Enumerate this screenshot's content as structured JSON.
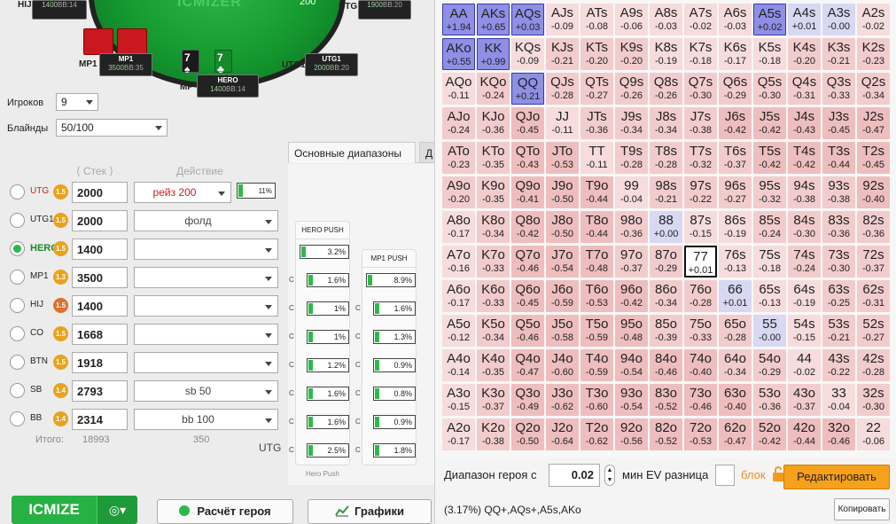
{
  "table": {
    "logo": "ICMIZER",
    "pot": "200",
    "seats": [
      {
        "name": "HIJ",
        "stack": "1400",
        "bb": "BB:14"
      },
      {
        "name": "UTG",
        "stack": "1900",
        "bb": "BB:20"
      },
      {
        "name": "MP1",
        "stack": "3500",
        "bb": "BB:35"
      },
      {
        "name": "HERO",
        "stack": "1400",
        "bb": "BB:14"
      },
      {
        "name": "UTG1",
        "stack": "2000",
        "bb": "BB:20"
      }
    ],
    "labels": {
      "hij": "HIJ",
      "utg": "UTG",
      "mp1": "MP1",
      "mp": "MP",
      "utg1": "UTG1"
    },
    "hero_cards": [
      {
        "rank": "7",
        "suit": "♠"
      },
      {
        "rank": "7",
        "suit": "♣"
      }
    ]
  },
  "settings": {
    "players_label": "Игроков",
    "players_value": "9",
    "blinds_label": "Блайнды",
    "blinds_value": "50/100",
    "stack_header": "Стек",
    "action_header": "Действие"
  },
  "players": [
    {
      "pos": "UTG",
      "coin": "1.5",
      "stack": "2000",
      "action": "рейз 200",
      "pct": "11%"
    },
    {
      "pos": "UTG1",
      "coin": "1.5",
      "stack": "2000",
      "action": "фолд",
      "pct": ""
    },
    {
      "pos": "HERO",
      "coin": "1.5",
      "stack": "1400",
      "action": "",
      "pct": ""
    },
    {
      "pos": "MP1",
      "coin": "1.3",
      "stack": "3500",
      "action": "",
      "pct": ""
    },
    {
      "pos": "HIJ",
      "coin": "1.5",
      "stack": "1400",
      "action": "",
      "pct": ""
    },
    {
      "pos": "CO",
      "coin": "1.5",
      "stack": "1668",
      "action": "",
      "pct": ""
    },
    {
      "pos": "BTN",
      "coin": "1.5",
      "stack": "1918",
      "action": "",
      "pct": ""
    },
    {
      "pos": "SB",
      "coin": "1.4",
      "stack": "2793",
      "action": "sb 50",
      "pct": ""
    },
    {
      "pos": "BB",
      "coin": "1.4",
      "stack": "2314",
      "action": "bb 100",
      "pct": ""
    }
  ],
  "totals": {
    "label": "Итого:",
    "stack": "18993",
    "action": "350",
    "utg": "UTG"
  },
  "tabs": {
    "main": "Основные диапазоны",
    "second": "Д"
  },
  "hero_push": {
    "title": "HERO PUSH",
    "values": [
      "3.2%",
      "1.6%",
      "1%",
      "1%",
      "1.2%",
      "1.6%",
      "1.6%",
      "2.5%"
    ],
    "prefix": "C",
    "footer": "Hero Push"
  },
  "mp1_push": {
    "title": "MP1 PUSH",
    "values": [
      "8.9%",
      "1.6%",
      "1.3%",
      "0.9%",
      "0.8%",
      "0.9%",
      "1.8%"
    ],
    "prefix": "C"
  },
  "buttons": {
    "icmize": "ICMIZE",
    "icmize_drop": "◎▾",
    "calc_hero": "Расчёт героя",
    "charts": "Графики",
    "edit": "Редактировать",
    "copy": "Копировать"
  },
  "range_controls": {
    "hero_range_label": "Диапазон героя с",
    "hero_range_value": "0.02",
    "min_ev_label": "мин EV разница",
    "block_label": "блок",
    "summary": "(3.17%) QQ+,AQs+,A5s,AKo"
  },
  "grid": [
    [
      [
        "AA",
        "+1.94"
      ],
      [
        "AKs",
        "+0.65"
      ],
      [
        "AQs",
        "+0.03"
      ],
      [
        "AJs",
        "-0.09"
      ],
      [
        "ATs",
        "-0.08"
      ],
      [
        "A9s",
        "-0.06"
      ],
      [
        "A8s",
        "-0.03"
      ],
      [
        "A7s",
        "-0.02"
      ],
      [
        "A6s",
        "-0.03"
      ],
      [
        "A5s",
        "+0.02"
      ],
      [
        "A4s",
        "+0.01"
      ],
      [
        "A3s",
        "-0.00"
      ],
      [
        "A2s",
        "-0.02"
      ]
    ],
    [
      [
        "AKo",
        "+0.55"
      ],
      [
        "KK",
        "+0.99"
      ],
      [
        "KQs",
        "-0.09"
      ],
      [
        "KJs",
        "-0.21"
      ],
      [
        "KTs",
        "-0.20"
      ],
      [
        "K9s",
        "-0.20"
      ],
      [
        "K8s",
        "-0.19"
      ],
      [
        "K7s",
        "-0.18"
      ],
      [
        "K6s",
        "-0.17"
      ],
      [
        "K5s",
        "-0.18"
      ],
      [
        "K4s",
        "-0.20"
      ],
      [
        "K3s",
        "-0.21"
      ],
      [
        "K2s",
        "-0.23"
      ]
    ],
    [
      [
        "AQo",
        "-0.11"
      ],
      [
        "KQo",
        "-0.24"
      ],
      [
        "QQ",
        "+0.21"
      ],
      [
        "QJs",
        "-0.28"
      ],
      [
        "QTs",
        "-0.27"
      ],
      [
        "Q9s",
        "-0.26"
      ],
      [
        "Q8s",
        "-0.26"
      ],
      [
        "Q7s",
        "-0.30"
      ],
      [
        "Q6s",
        "-0.29"
      ],
      [
        "Q5s",
        "-0.30"
      ],
      [
        "Q4s",
        "-0.31"
      ],
      [
        "Q3s",
        "-0.33"
      ],
      [
        "Q2s",
        "-0.34"
      ]
    ],
    [
      [
        "AJo",
        "-0.24"
      ],
      [
        "KJo",
        "-0.36"
      ],
      [
        "QJo",
        "-0.45"
      ],
      [
        "JJ",
        "-0.11"
      ],
      [
        "JTs",
        "-0.36"
      ],
      [
        "J9s",
        "-0.34"
      ],
      [
        "J8s",
        "-0.34"
      ],
      [
        "J7s",
        "-0.38"
      ],
      [
        "J6s",
        "-0.42"
      ],
      [
        "J5s",
        "-0.42"
      ],
      [
        "J4s",
        "-0.43"
      ],
      [
        "J3s",
        "-0.45"
      ],
      [
        "J2s",
        "-0.47"
      ]
    ],
    [
      [
        "ATo",
        "-0.23"
      ],
      [
        "KTo",
        "-0.35"
      ],
      [
        "QTo",
        "-0.43"
      ],
      [
        "JTo",
        "-0.53"
      ],
      [
        "TT",
        "-0.11"
      ],
      [
        "T9s",
        "-0.28"
      ],
      [
        "T8s",
        "-0.28"
      ],
      [
        "T7s",
        "-0.32"
      ],
      [
        "T6s",
        "-0.37"
      ],
      [
        "T5s",
        "-0.42"
      ],
      [
        "T4s",
        "-0.42"
      ],
      [
        "T3s",
        "-0.44"
      ],
      [
        "T2s",
        "-0.45"
      ]
    ],
    [
      [
        "A9o",
        "-0.20"
      ],
      [
        "K9o",
        "-0.35"
      ],
      [
        "Q9o",
        "-0.41"
      ],
      [
        "J9o",
        "-0.50"
      ],
      [
        "T9o",
        "-0.44"
      ],
      [
        "99",
        "-0.04"
      ],
      [
        "98s",
        "-0.21"
      ],
      [
        "97s",
        "-0.22"
      ],
      [
        "96s",
        "-0.27"
      ],
      [
        "95s",
        "-0.32"
      ],
      [
        "94s",
        "-0.38"
      ],
      [
        "93s",
        "-0.38"
      ],
      [
        "92s",
        "-0.40"
      ]
    ],
    [
      [
        "A8o",
        "-0.17"
      ],
      [
        "K8o",
        "-0.34"
      ],
      [
        "Q8o",
        "-0.42"
      ],
      [
        "J8o",
        "-0.50"
      ],
      [
        "T8o",
        "-0.44"
      ],
      [
        "98o",
        "-0.36"
      ],
      [
        "88",
        "+0.00"
      ],
      [
        "87s",
        "-0.15"
      ],
      [
        "86s",
        "-0.19"
      ],
      [
        "85s",
        "-0.24"
      ],
      [
        "84s",
        "-0.30"
      ],
      [
        "83s",
        "-0.36"
      ],
      [
        "82s",
        "-0.36"
      ]
    ],
    [
      [
        "A7o",
        "-0.16"
      ],
      [
        "K7o",
        "-0.33"
      ],
      [
        "Q7o",
        "-0.46"
      ],
      [
        "J7o",
        "-0.54"
      ],
      [
        "T7o",
        "-0.48"
      ],
      [
        "97o",
        "-0.37"
      ],
      [
        "87o",
        "-0.29"
      ],
      [
        "77",
        "+0.01"
      ],
      [
        "76s",
        "-0.13"
      ],
      [
        "75s",
        "-0.18"
      ],
      [
        "74s",
        "-0.24"
      ],
      [
        "73s",
        "-0.30"
      ],
      [
        "72s",
        "-0.37"
      ]
    ],
    [
      [
        "A6o",
        "-0.17"
      ],
      [
        "K6o",
        "-0.33"
      ],
      [
        "Q6o",
        "-0.45"
      ],
      [
        "J6o",
        "-0.59"
      ],
      [
        "T6o",
        "-0.53"
      ],
      [
        "96o",
        "-0.42"
      ],
      [
        "86o",
        "-0.34"
      ],
      [
        "76o",
        "-0.28"
      ],
      [
        "66",
        "+0.01"
      ],
      [
        "65s",
        "-0.13"
      ],
      [
        "64s",
        "-0.19"
      ],
      [
        "63s",
        "-0.25"
      ],
      [
        "62s",
        "-0.31"
      ]
    ],
    [
      [
        "A5o",
        "-0.12"
      ],
      [
        "K5o",
        "-0.34"
      ],
      [
        "Q5o",
        "-0.46"
      ],
      [
        "J5o",
        "-0.58"
      ],
      [
        "T5o",
        "-0.59"
      ],
      [
        "95o",
        "-0.48"
      ],
      [
        "85o",
        "-0.39"
      ],
      [
        "75o",
        "-0.33"
      ],
      [
        "65o",
        "-0.28"
      ],
      [
        "55",
        "-0.00"
      ],
      [
        "54s",
        "-0.15"
      ],
      [
        "53s",
        "-0.21"
      ],
      [
        "52s",
        "-0.27"
      ]
    ],
    [
      [
        "A4o",
        "-0.14"
      ],
      [
        "K4o",
        "-0.35"
      ],
      [
        "Q4o",
        "-0.47"
      ],
      [
        "J4o",
        "-0.60"
      ],
      [
        "T4o",
        "-0.59"
      ],
      [
        "94o",
        "-0.54"
      ],
      [
        "84o",
        "-0.46"
      ],
      [
        "74o",
        "-0.40"
      ],
      [
        "64o",
        "-0.34"
      ],
      [
        "54o",
        "-0.29"
      ],
      [
        "44",
        "-0.02"
      ],
      [
        "43s",
        "-0.22"
      ],
      [
        "42s",
        "-0.28"
      ]
    ],
    [
      [
        "A3o",
        "-0.15"
      ],
      [
        "K3o",
        "-0.37"
      ],
      [
        "Q3o",
        "-0.49"
      ],
      [
        "J3o",
        "-0.62"
      ],
      [
        "T3o",
        "-0.60"
      ],
      [
        "93o",
        "-0.54"
      ],
      [
        "83o",
        "-0.52"
      ],
      [
        "73o",
        "-0.46"
      ],
      [
        "63o",
        "-0.40"
      ],
      [
        "53o",
        "-0.36"
      ],
      [
        "43o",
        "-0.37"
      ],
      [
        "33",
        "-0.04"
      ],
      [
        "32s",
        "-0.30"
      ]
    ],
    [
      [
        "A2o",
        "-0.17"
      ],
      [
        "K2o",
        "-0.38"
      ],
      [
        "Q2o",
        "-0.50"
      ],
      [
        "J2o",
        "-0.64"
      ],
      [
        "T2o",
        "-0.62"
      ],
      [
        "92o",
        "-0.56"
      ],
      [
        "82o",
        "-0.52"
      ],
      [
        "72o",
        "-0.53"
      ],
      [
        "62o",
        "-0.47"
      ],
      [
        "52o",
        "-0.42"
      ],
      [
        "42o",
        "-0.44"
      ],
      [
        "32o",
        "-0.46"
      ],
      [
        "22",
        "-0.06"
      ]
    ]
  ],
  "grid_selected": [
    "AA",
    "AKs",
    "AQs",
    "A5s",
    "AKo",
    "KK",
    "QQ"
  ],
  "grid_current": "77",
  "colors": {
    "accent_green": "#27b044",
    "select_blue": "#8f8fe6",
    "edit_orange": "#f7a01c"
  }
}
